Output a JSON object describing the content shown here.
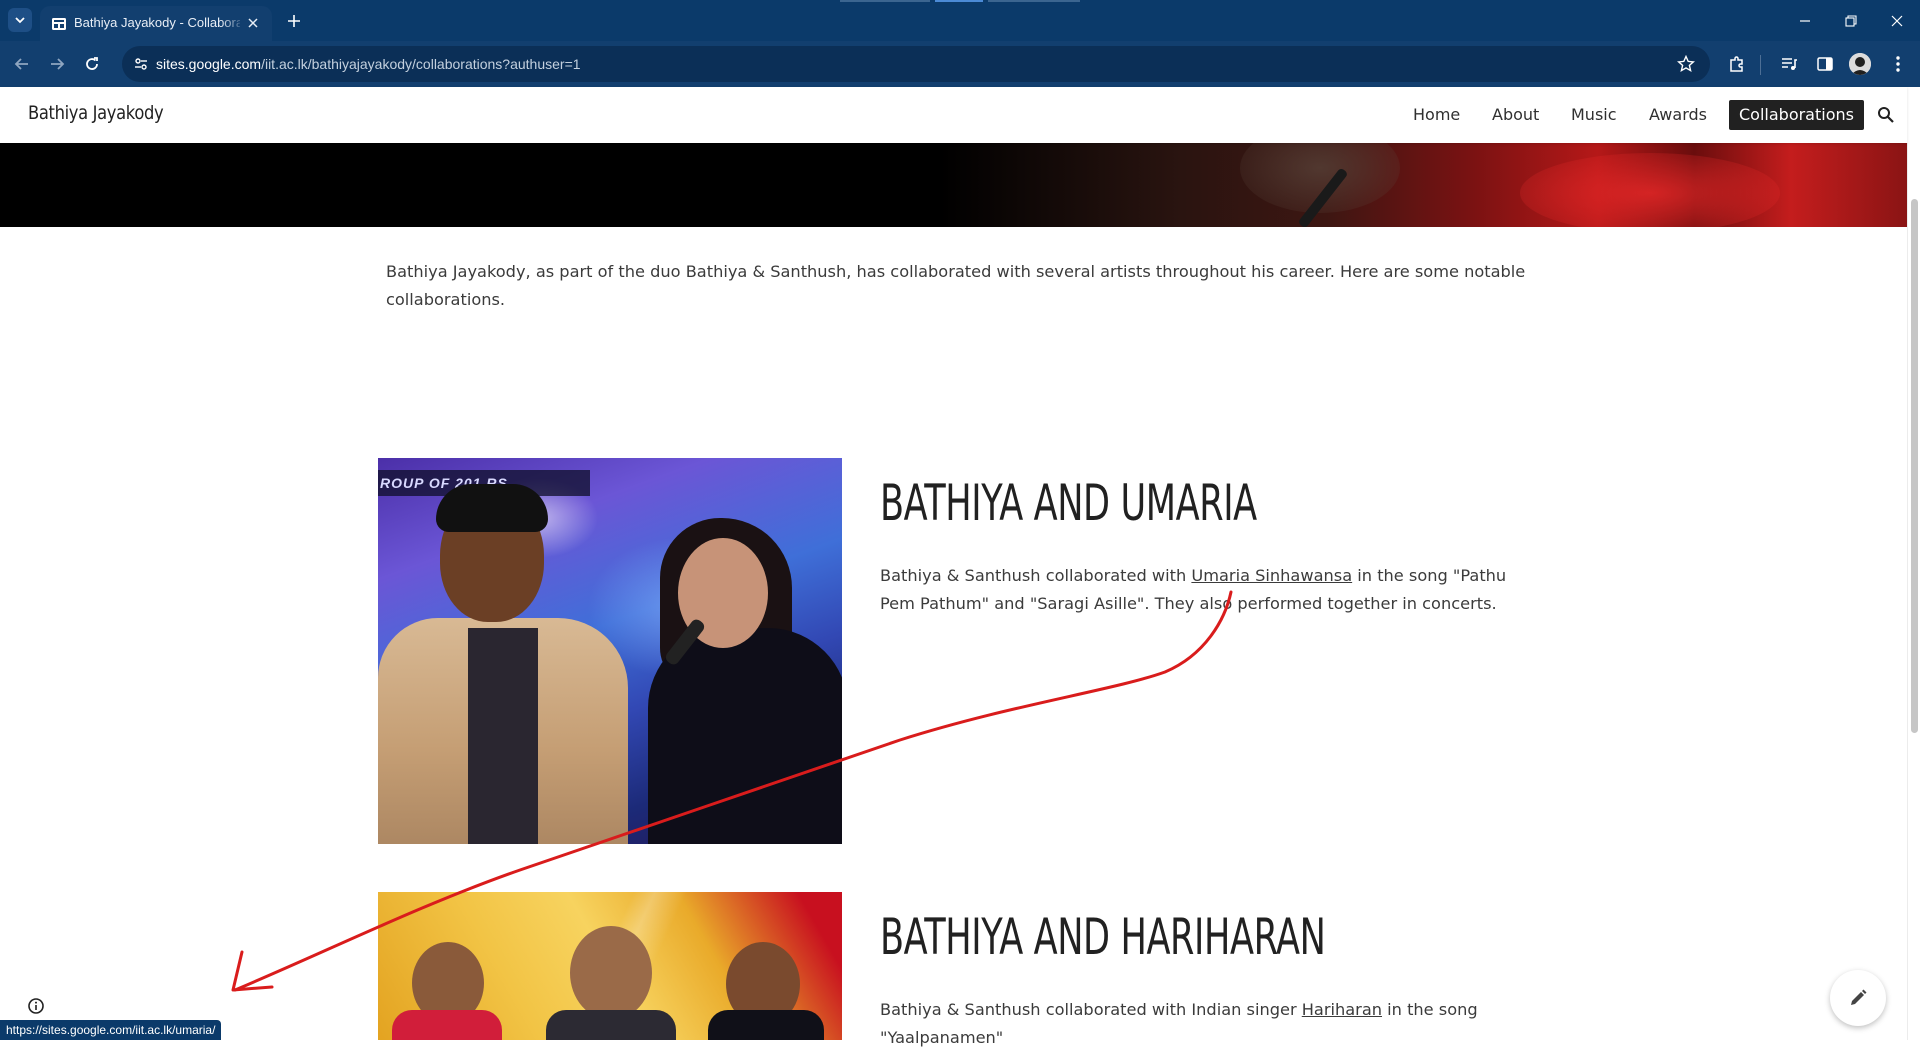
{
  "browser": {
    "tab": {
      "title": "Bathiya Jayakody - Collaborations",
      "favicon": "google-sites-icon"
    },
    "url": {
      "host": "sites.google.com",
      "path": "/iit.ac.lk/bathiyajayakody/collaborations?authuser=1"
    },
    "status_link": "https://sites.google.com/iit.ac.lk/umaria/",
    "colors": {
      "frame": "#0b3a6a",
      "toolbar": "#123f6f",
      "omnibox": "#0b2f57"
    }
  },
  "site": {
    "title": "Bathiya Jayakody",
    "nav": {
      "home": "Home",
      "about": "About",
      "music": "Music",
      "awards": "Awards",
      "collaborations": "Collaborations"
    },
    "active_nav": "Collaborations"
  },
  "content": {
    "intro": "Bathiya Jayakody, as part of the duo Bathiya & Santhush, has collaborated with several artists throughout his career. Here are some notable collaborations.",
    "sections": [
      {
        "title": "BATHIYA AND UMARIA",
        "text_before": "Bathiya & Santhush collaborated with ",
        "link": "Umaria Sinhawansa",
        "text_after": " in the song \"Pathu Pem Pathum\" and \"Saragi Asille\". They also performed together in concerts.",
        "image_banner": "ROUP OF 201      RS"
      },
      {
        "title": "BATHIYA AND HARIHARAN",
        "text_before": "Bathiya & Santhush collaborated with Indian singer ",
        "link": "Hariharan",
        "text_after": " in the song \"Yaalpanamen\""
      }
    ]
  },
  "annotation_color": "#d91c1c"
}
